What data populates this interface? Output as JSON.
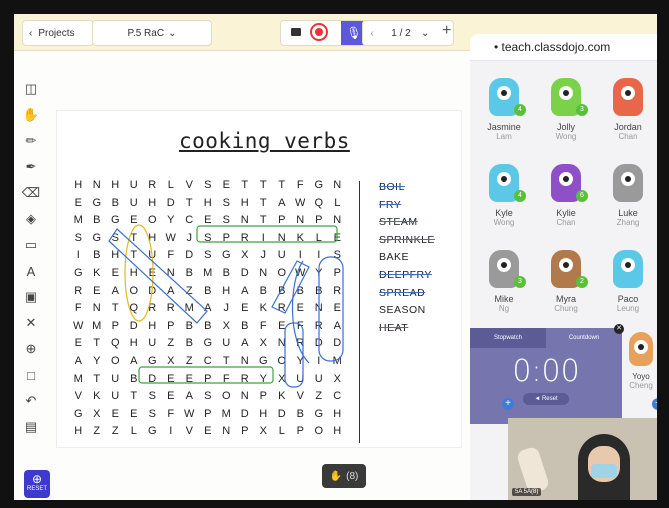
{
  "toolbar": {
    "projects_label": "Projects",
    "class_label": "P.5 RaC",
    "page_indicator": "1 / 2"
  },
  "sheet": {
    "title": "cooking verbs",
    "grid": [
      [
        "H",
        "N",
        "H",
        "U",
        "R",
        "L",
        "V",
        "S",
        "E",
        "T",
        "T",
        "T",
        "F",
        "G",
        "N"
      ],
      [
        "E",
        "G",
        "B",
        "U",
        "H",
        "D",
        "T",
        "H",
        "S",
        "H",
        "T",
        "A",
        "W",
        "Q",
        "L"
      ],
      [
        "M",
        "B",
        "G",
        "E",
        "O",
        "Y",
        "C",
        "E",
        "S",
        "N",
        "T",
        "P",
        "N",
        "P",
        "N"
      ],
      [
        "S",
        "G",
        "S",
        "T",
        "H",
        "W",
        "J",
        "S",
        "P",
        "R",
        "I",
        "N",
        "K",
        "L",
        "E"
      ],
      [
        "I",
        "B",
        "H",
        "T",
        "U",
        "F",
        "D",
        "S",
        "G",
        "X",
        "J",
        "U",
        "I",
        "I",
        "S"
      ],
      [
        "G",
        "K",
        "E",
        "H",
        "E",
        "N",
        "B",
        "M",
        "B",
        "D",
        "N",
        "O",
        "W",
        "Y",
        "P"
      ],
      [
        "R",
        "E",
        "A",
        "O",
        "D",
        "A",
        "Z",
        "B",
        "H",
        "A",
        "B",
        "B",
        "B",
        "B",
        "R"
      ],
      [
        "F",
        "N",
        "T",
        "Q",
        "R",
        "R",
        "M",
        "A",
        "J",
        "E",
        "K",
        "R",
        "E",
        "N",
        "E"
      ],
      [
        "W",
        "M",
        "P",
        "D",
        "H",
        "P",
        "B",
        "B",
        "X",
        "B",
        "F",
        "E",
        "F",
        "R",
        "A"
      ],
      [
        "E",
        "T",
        "Q",
        "H",
        "U",
        "Z",
        "B",
        "G",
        "U",
        "A",
        "X",
        "N",
        "R",
        "D",
        "D"
      ],
      [
        "A",
        "Y",
        "O",
        "A",
        "G",
        "X",
        "Z",
        "C",
        "T",
        "N",
        "G",
        "O",
        "Y",
        "I",
        "M"
      ],
      [
        "M",
        "T",
        "U",
        "B",
        "D",
        "E",
        "E",
        "P",
        "F",
        "R",
        "Y",
        "X",
        "U",
        "U",
        "X"
      ],
      [
        "V",
        "K",
        "U",
        "T",
        "S",
        "E",
        "A",
        "S",
        "O",
        "N",
        "P",
        "K",
        "V",
        "Z",
        "C"
      ],
      [
        "G",
        "X",
        "E",
        "E",
        "S",
        "F",
        "W",
        "P",
        "M",
        "D",
        "H",
        "D",
        "B",
        "G",
        "H"
      ],
      [
        "H",
        "Z",
        "Z",
        "L",
        "G",
        "I",
        "V",
        "E",
        "N",
        "P",
        "X",
        "L",
        "P",
        "O",
        "H"
      ]
    ],
    "words": [
      {
        "text": "BOIL",
        "found": true
      },
      {
        "text": "FRY",
        "found": true
      },
      {
        "text": "STEAM",
        "found": true
      },
      {
        "text": "SPRINKLE",
        "found": true
      },
      {
        "text": "BAKE",
        "found": false
      },
      {
        "text": "DEEPFRY",
        "found": true
      },
      {
        "text": "SPREAD",
        "found": true
      },
      {
        "text": "SEASON",
        "found": false
      },
      {
        "text": "HEAT",
        "found": true
      }
    ]
  },
  "reset_label": "RESET",
  "hand_count": "(8)",
  "dojo": {
    "url": "teach.classdojo.com",
    "students": [
      {
        "first": "Jasmine",
        "last": "Lam",
        "points": "4",
        "color": "#5bc8e8"
      },
      {
        "first": "Jolly",
        "last": "Wong",
        "points": "3",
        "color": "#7bd14a"
      },
      {
        "first": "Jordan",
        "last": "Chan",
        "points": "",
        "color": "#e8674a"
      },
      {
        "first": "Kyle",
        "last": "Wong",
        "points": "4",
        "color": "#5bc8e8"
      },
      {
        "first": "Kylie",
        "last": "Chan",
        "points": "6",
        "color": "#8f4fc9"
      },
      {
        "first": "Luke",
        "last": "Zhang",
        "points": "",
        "color": "#9a9a9a"
      },
      {
        "first": "Mike",
        "last": "Ng",
        "points": "3",
        "color": "#9a9a9a"
      },
      {
        "first": "Myra",
        "last": "Chung",
        "points": "2",
        "color": "#b07a4a"
      },
      {
        "first": "Paco",
        "last": "Leung",
        "points": "",
        "color": "#5bc8e8"
      }
    ],
    "timer": {
      "tab_stopwatch": "Stopwatch",
      "tab_countdown": "Countdown",
      "time": "0:00",
      "reset": "Reset"
    },
    "side_student": {
      "first": "Yoyo",
      "last": "Cheng"
    },
    "video_label": "5A 5A(8)"
  }
}
